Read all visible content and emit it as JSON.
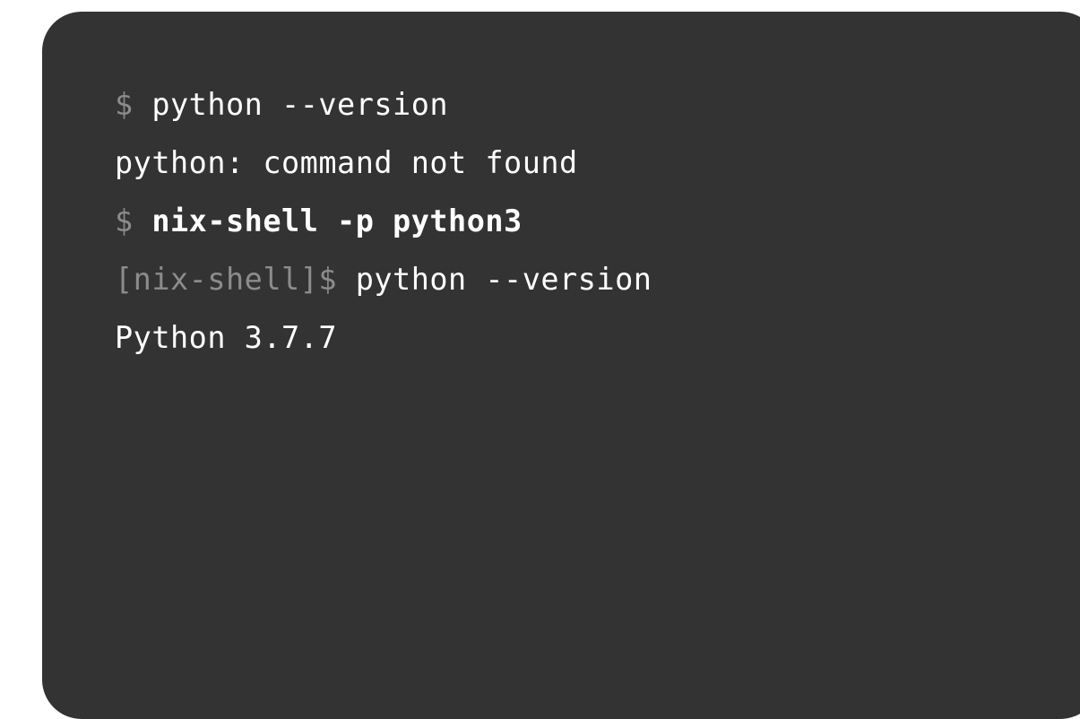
{
  "terminal": {
    "lines": [
      {
        "prompt": "$ ",
        "command": "python --version"
      },
      {
        "output": "python: command not found"
      },
      {
        "prompt": "$ ",
        "command": "nix-shell -p python3"
      },
      {
        "prompt": "[nix-shell]$ ",
        "command": "python --version"
      },
      {
        "output": "Python 3.7.7"
      }
    ]
  },
  "colors": {
    "background": "#333333",
    "prompt": "#8c8c8c",
    "text": "#ffffff"
  }
}
